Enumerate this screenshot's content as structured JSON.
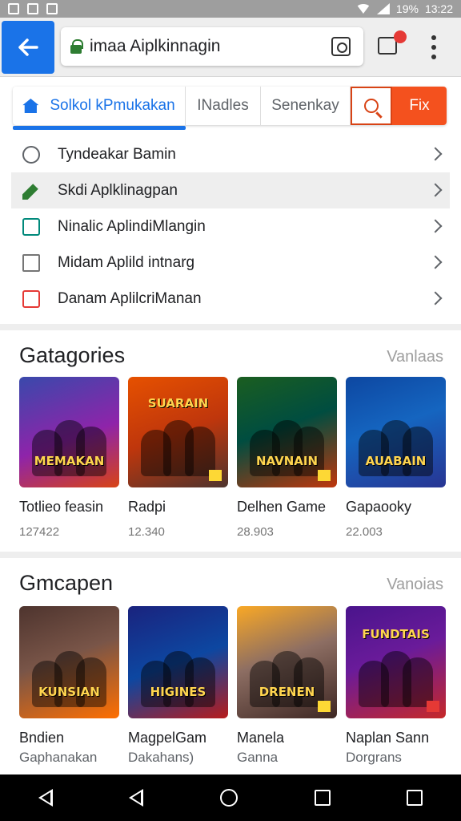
{
  "status_bar": {
    "battery": "19%",
    "time": "13:22"
  },
  "toolbar": {
    "url": "imaa Aiplkinnagin"
  },
  "tabs": {
    "active": "Solkol kPmukakan",
    "second": "INadles",
    "third": "Senenkay",
    "fix_button": "Fix"
  },
  "menu_list": [
    {
      "label": "Tyndeakar Bamin",
      "icon": "search-icon"
    },
    {
      "label": "Skdi Aplklinagpan",
      "icon": "edit-icon"
    },
    {
      "label": "Ninalic AplindiMlangin",
      "icon": "box-icon"
    },
    {
      "label": "Midam Aplild intnarg",
      "icon": "document-icon"
    },
    {
      "label": "Danam AplilcriManan",
      "icon": "calendar-icon"
    }
  ],
  "categories": {
    "title": "Gatagories",
    "more": "Vanlaas",
    "cards": [
      {
        "name": "Totlieo feasin",
        "count": "127422",
        "logo": "MEMAKAN"
      },
      {
        "name": "Radpi",
        "count": "12.340",
        "logo": "SUARAIN"
      },
      {
        "name": "Delhen Game",
        "count": "28.903",
        "logo": "NAVNAIN"
      },
      {
        "name": "Gapaooky",
        "count": "22.003",
        "logo": "AUABAIN"
      }
    ]
  },
  "games": {
    "title": "Gmcapen",
    "more": "Vanoias",
    "cards": [
      {
        "name": "Bndien",
        "sub": "Gaphanakan",
        "logo": "KUNSIAN"
      },
      {
        "name": "MagpelGam",
        "sub": "Dakahans)",
        "logo": "HIGINES"
      },
      {
        "name": "Manela",
        "sub": "Ganna",
        "logo": "DRENEN"
      },
      {
        "name": "Naplan Sann",
        "sub": "Dorgrans",
        "logo": "FUNDTAIS"
      }
    ]
  },
  "colors": {
    "accent": "#1a73e8",
    "fix": "#f4511e"
  }
}
